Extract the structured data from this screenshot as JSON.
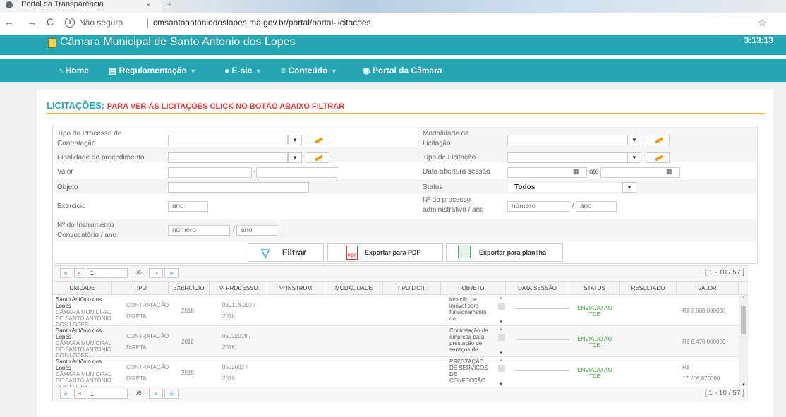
{
  "browser": {
    "tab_title": "Portal da Transparência",
    "tab_close": "×",
    "new_tab": "+",
    "security": "Não seguro",
    "url": "cmsantoantoniodoslopes.ma.gov.br/portal/portal-licitacoes"
  },
  "site": {
    "name": "Câmara Municipal de Santo Antonio dos Lopes",
    "clock": "3:13:13"
  },
  "menu": {
    "items": [
      {
        "label": "Home",
        "icon": "home-icon"
      },
      {
        "label": "Regulamentação",
        "icon": "document-icon",
        "dropdown": true
      },
      {
        "label": "E-sic",
        "icon": "info-icon",
        "dropdown": true
      },
      {
        "label": "Conteúdo",
        "icon": "list-icon",
        "dropdown": true
      },
      {
        "label": "Portal da Câmara",
        "icon": "globe-icon"
      }
    ]
  },
  "heading": {
    "title": "LICITAÇÕES:",
    "subtitle": "PARA VER ÀS LICITAÇÕES CLICK NO BOTÃO ABAIXO FILTRAR"
  },
  "filters": {
    "tipo_processo_line1": "Tipo do Processo de",
    "tipo_processo_line2": "Contratação",
    "modalidade_line1": "Modalidade da",
    "modalidade_line2": "Licitação",
    "finalidade": "Finalidade do procedimento",
    "tipo_licitacao": "Tipo de Licitação",
    "valor": "Valor",
    "valor_sep": "-",
    "data_abertura": "Data abertura sessão",
    "ate": "até",
    "objeto": "Objeto",
    "status": "Status",
    "status_value": "Todos",
    "exercicio": "Exercicio",
    "exercicio_placeholder": "ano",
    "processo_line1": "Nº do processo",
    "processo_line2": "administrativo / ano",
    "numero_placeholder": "número",
    "ano_placeholder": "ano",
    "slash": "/",
    "instrumento_line1": "Nº do Instrumento",
    "instrumento_line2": "Convocatório / ano"
  },
  "buttons": {
    "filtrar": "Filtrar",
    "exportar_pdf": "Exportar para PDF",
    "exportar_planilha": "Exportar para planilha"
  },
  "pager": {
    "first": "«",
    "prev": "<",
    "page": "1",
    "of": "/6",
    "next": ">",
    "last": "»",
    "info": "[ 1 - 10 / 57 ]"
  },
  "table": {
    "headers": [
      "UNIDADE",
      "TIPO",
      "EXERCÍCIO",
      "Nº PROCESSO",
      "Nº INSTRUM.",
      "MODALIDADE",
      "TIPO LICIT.",
      "OBJETO",
      "DATA SESSÃO",
      "STATUS",
      "RESULTADO",
      "VALOR"
    ],
    "rows": [
      {
        "unidade_1": "Santo Antônio dos Lopes",
        "unidade_2": "CÂMARA MUNICIPAL DE SANTO ANTONIO DOS LOPES",
        "tipo_1": "CONTRATAÇÃO",
        "tipo_2": "DIRETA",
        "exercicio": "2018",
        "processo_1": "030118-002 /",
        "processo_2": "2018",
        "objeto": "locação de imóvel para funcionamento do",
        "status": "ENVIADO AO TCE",
        "valor": "R$ 3.600,000000"
      },
      {
        "unidade_1": "Santo Antônio dos Lopes",
        "unidade_2": "CÂMARA MUNICIPAL DE SANTO ANTONIO DOS LOPES",
        "tipo_1": "CONTRATAÇÃO",
        "tipo_2": "DIRETA",
        "exercicio": "2018",
        "processo_1": "05022018 /",
        "processo_2": "2018",
        "objeto": "Contratação de empresa para prestação de serviços de",
        "status": "ENVIADO AO TCE",
        "valor": "R$ 6.470,000000"
      },
      {
        "unidade_1": "Santo Antônio dos Lopes",
        "unidade_2": "CÂMARA MUNICIPAL DE SANTO ANTONIO DOS LOPES",
        "tipo_1": "CONTRATAÇÃO",
        "tipo_2": "DIRETA",
        "exercicio": "2019",
        "processo_1": "0502002 /",
        "processo_2": "2019",
        "objeto": "PRESTAÇÃO DE SERVIÇOS DE CONFECÇÃO",
        "status": "ENVIADO AO TCE",
        "valor_1": "R$",
        "valor_2": "17.206,670000"
      }
    ]
  }
}
